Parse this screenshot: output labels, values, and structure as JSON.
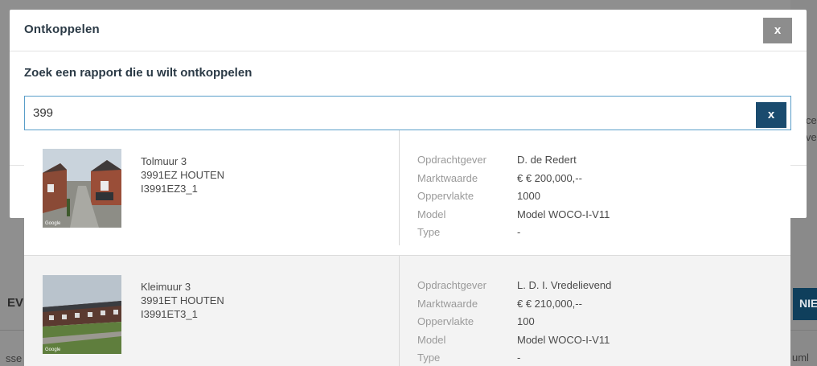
{
  "background": {
    "text_ce": "ce",
    "text_ve": "ve",
    "button_ni": "NIE",
    "text_ev": "EV",
    "text_sse": "sse",
    "text_uml": "uml"
  },
  "modal": {
    "title": "Ontkoppelen",
    "close_label": "x",
    "subtitle": "Zoek een rapport die u wilt ontkoppelen"
  },
  "search": {
    "value": "399",
    "clear_label": "x"
  },
  "labels": {
    "client": "Opdrachtgever",
    "market_value": "Marktwaarde",
    "area": "Oppervlakte",
    "model": "Model",
    "type": "Type"
  },
  "results": [
    {
      "street": "Tolmuur 3",
      "city": "3991EZ HOUTEN",
      "code": "I3991EZ3_1",
      "client": "D. de Redert",
      "market_value": "€ € 200,000,--",
      "area": "1000",
      "model": "Model WOCO-I-V11",
      "type": "-"
    },
    {
      "street": "Kleimuur 3",
      "city": "3991ET HOUTEN",
      "code": "I3991ET3_1",
      "client": "L. D. I. Vredelievend",
      "market_value": "€ € 210,000,--",
      "area": "100",
      "model": "Model WOCO-I-V11",
      "type": "-"
    }
  ],
  "thumbnail_watermark": "Google"
}
